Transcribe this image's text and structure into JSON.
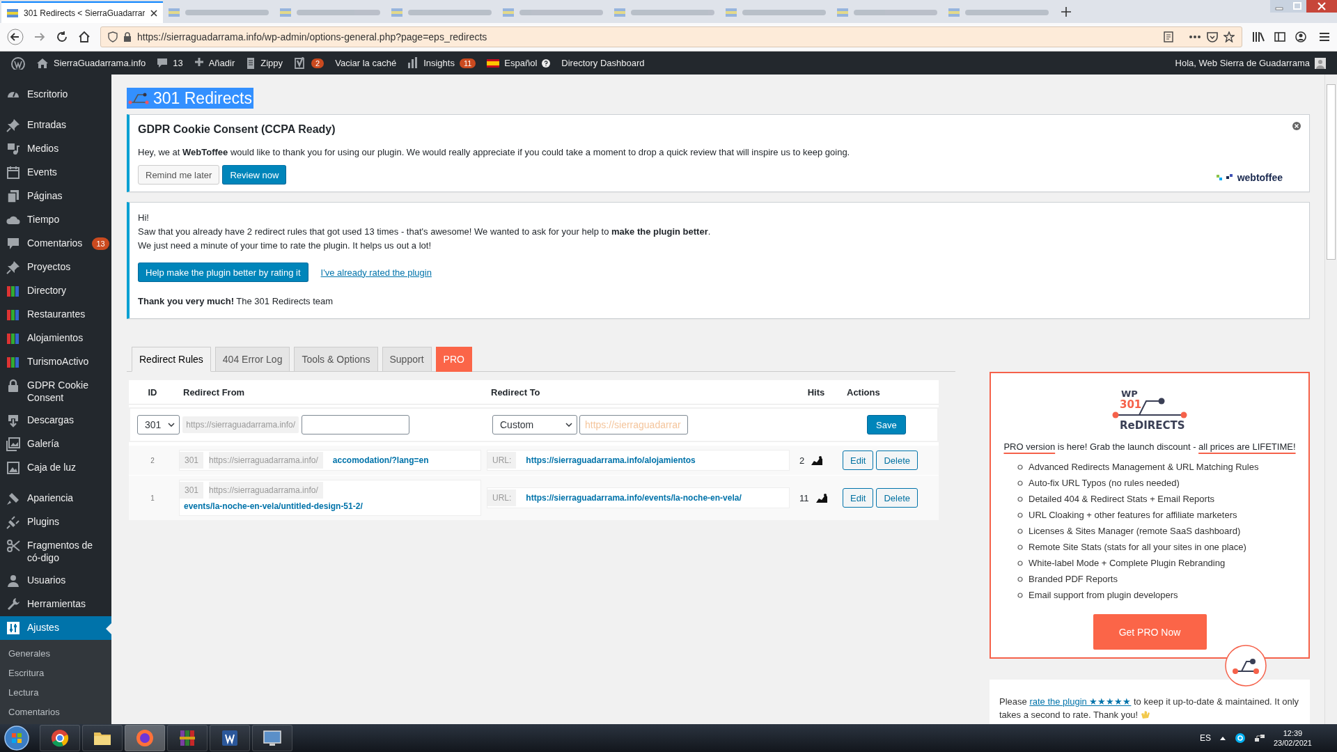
{
  "browser": {
    "tabs": [
      {
        "title": "301 Redirects < SierraGuadarrar",
        "selected": true
      },
      {
        "selected": false
      },
      {
        "selected": false
      },
      {
        "selected": false
      },
      {
        "selected": false
      },
      {
        "selected": false
      },
      {
        "selected": false
      },
      {
        "selected": false
      },
      {
        "selected": false
      }
    ],
    "url": "https://sierraguadarrama.info/wp-admin/options-general.php?page=eps_redirects"
  },
  "admin_bar": {
    "items": [
      {
        "kind": "logo"
      },
      {
        "kind": "home",
        "label": "SierraGuadarrama.info"
      },
      {
        "kind": "comment",
        "label": "13"
      },
      {
        "kind": "plus",
        "label": "Añadir"
      },
      {
        "kind": "page",
        "label": "Zippy"
      },
      {
        "kind": "yoast",
        "badge": "2"
      },
      {
        "kind": "text",
        "label": "Vaciar la caché"
      },
      {
        "kind": "chart",
        "label": "Insights",
        "badge": "11"
      },
      {
        "kind": "flag",
        "label": "Español",
        "help": true
      },
      {
        "kind": "text",
        "label": "Directory Dashboard"
      }
    ],
    "greeting": "Hola, Web Sierra de Guadarrama"
  },
  "sidebar": {
    "items": [
      {
        "label": "Escritorio",
        "kind": "dashboard",
        "selected": false,
        "gap": true
      },
      {
        "label": "Entradas",
        "kind": "pin",
        "selected": false
      },
      {
        "label": "Medios",
        "kind": "media",
        "selected": false
      },
      {
        "label": "Events",
        "kind": "calendar",
        "selected": false
      },
      {
        "label": "Páginas",
        "kind": "pages",
        "selected": false
      },
      {
        "label": "Tiempo",
        "kind": "cloud",
        "selected": false
      },
      {
        "label": "Comentarios",
        "kind": "comment",
        "selected": false,
        "badge": "13"
      },
      {
        "label": "Proyectos",
        "kind": "pin",
        "selected": false
      },
      {
        "label": "Directory",
        "kind": "books",
        "selected": false
      },
      {
        "label": "Restaurantes",
        "kind": "books",
        "selected": false
      },
      {
        "label": "Alojamientos",
        "kind": "books",
        "selected": false
      },
      {
        "label": "TurismoActivo",
        "kind": "books",
        "selected": false
      },
      {
        "label": "GDPR Cookie Consent",
        "kind": "lock",
        "selected": false
      },
      {
        "label": "Descargas",
        "kind": "download",
        "selected": false
      },
      {
        "label": "Galería",
        "kind": "gallery",
        "selected": false
      },
      {
        "label": "Caja de luz",
        "kind": "image",
        "selected": false,
        "gap": true
      },
      {
        "label": "Apariencia",
        "kind": "brush",
        "selected": false
      },
      {
        "label": "Plugins",
        "kind": "plug",
        "selected": false
      },
      {
        "label": "Fragmentos de có-digo",
        "kind": "scissors",
        "selected": false
      },
      {
        "label": "Usuarios",
        "kind": "user",
        "selected": false
      },
      {
        "label": "Herramientas",
        "kind": "wrench",
        "selected": false
      },
      {
        "label": "Ajustes",
        "kind": "sliders",
        "selected": true
      }
    ],
    "submenu": [
      {
        "label": "Generales",
        "selected": false
      },
      {
        "label": "Escritura",
        "selected": false
      },
      {
        "label": "Lectura",
        "selected": false
      },
      {
        "label": "Comentarios",
        "selected": false
      }
    ]
  },
  "main": {
    "title": "301 Redirects",
    "gdpr_notice": {
      "title": "GDPR Cookie Consent (CCPA Ready)",
      "text": "Hey, we at **WebToffee** would like to thank you for using our plugin. We would really appreciate if you could take a moment to drop a quick review that will inspire us to keep going.",
      "buttons": [
        {
          "label": "Remind me later",
          "kind": "secondary"
        },
        {
          "label": "Review now",
          "kind": "primary"
        }
      ],
      "brand": "webtoffee"
    },
    "rating_notice": {
      "lines": [
        "Hi!",
        "Saw that you already have 2 redirect rules that got used 13 times - that's awesome! We wanted to ask for your help to **make the plugin better**.",
        "We just need a minute of your time to rate the plugin. It helps us out a lot!"
      ],
      "button": "Help make the plugin better by rating it",
      "link": "I've already rated the plugin",
      "footer": "**Thank you very much!** The 301 Redirects team"
    },
    "tabs": [
      {
        "label": "Redirect Rules",
        "selected": true,
        "kind": "normal"
      },
      {
        "label": "404 Error Log",
        "selected": false,
        "kind": "normal"
      },
      {
        "label": "Tools & Options",
        "selected": false,
        "kind": "normal"
      },
      {
        "label": "Support",
        "selected": false,
        "kind": "normal"
      },
      {
        "label": "PRO",
        "selected": false,
        "kind": "pro"
      }
    ],
    "table": {
      "columns": [
        "ID",
        "Redirect From",
        "Redirect To",
        "Hits",
        "Actions"
      ],
      "new_rule": {
        "status": "301",
        "base": "https://sierraguadarrama.info/",
        "target_type": "Custom",
        "target_placeholder": "https://sierraguadarrar",
        "button": "Save"
      },
      "rows": [
        {
          "id": "2",
          "status": "301",
          "base": "https://sierraguadarrama.info/",
          "path": "accomodation/?lang=en",
          "url_label": "URL:",
          "url": "https://sierraguadarrama.info/alojamientos",
          "hits": "2",
          "actions": [
            "Edit",
            "Delete"
          ]
        },
        {
          "id": "1",
          "status": "301",
          "base": "https://sierraguadarrama.info/",
          "path": "events/la-noche-en-vela/untitled-design-51-2/",
          "url_label": "URL:",
          "url": "https://sierraguadarrama.info/events/la-noche-en-vela/",
          "hits": "11",
          "actions": [
            "Edit",
            "Delete"
          ]
        }
      ]
    },
    "pro_box": {
      "logo": {
        "top": "WP",
        "number": "301",
        "word": "ReDIRECTS"
      },
      "headline": {
        "lead": "PRO version",
        "middle": " is here! Grab the launch discount - ",
        "tail": "all prices are LIFETIME!"
      },
      "features": [
        "Advanced Redirects Management & URL Matching Rules",
        "Auto-fix URL Typos (no rules needed)",
        "Detailed 404 & Redirect Stats + Email Reports",
        "URL Cloaking + other features for affiliate marketers",
        "Licenses & Sites Manager (remote SaaS dashboard)",
        "Remote Site Stats (stats for all your sites in one place)",
        "White-label Mode + Complete Plugin Rebranding",
        "Branded PDF Reports",
        "Email support from plugin developers"
      ],
      "button": "Get PRO Now"
    },
    "rate_box": {
      "before": "Please ",
      "link": "rate the plugin ★★★★★",
      "after": " to keep it up-to-date & maintained. It only takes a second to rate. Thank you!"
    }
  },
  "taskbar": {
    "apps": [
      {
        "kind": "chrome",
        "selected": false
      },
      {
        "kind": "folder",
        "selected": false
      },
      {
        "kind": "firefox",
        "selected": true
      },
      {
        "kind": "archive",
        "selected": false
      },
      {
        "kind": "word",
        "selected": false
      },
      {
        "kind": "screen",
        "selected": false
      }
    ],
    "language": "ES",
    "time": "12:39",
    "date": "23/02/2021"
  }
}
